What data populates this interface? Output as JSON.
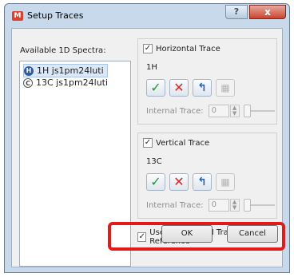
{
  "window": {
    "title": "Setup Traces",
    "help": "?",
    "close": "x"
  },
  "list": {
    "label": "Available 1D Spectra:",
    "items": [
      {
        "badge": "H",
        "label": "1H js1pm24luti"
      },
      {
        "badge": "C",
        "label": "13C js1pm24luti"
      }
    ]
  },
  "horizontal": {
    "checkbox_label": "Horizontal Trace",
    "checked": "✓",
    "nucleus": "1H",
    "internal_label": "Internal Trace:",
    "internal_value": "0"
  },
  "vertical": {
    "checkbox_label": "Vertical Trace",
    "checked": "✓",
    "nucleus": "13C",
    "internal_label": "Internal Trace:",
    "internal_value": "0"
  },
  "reference": {
    "checkbox_label": "Use External 1H Trace as Reference",
    "checked": "✓"
  },
  "buttons": {
    "ok": "OK",
    "cancel": "Cancel"
  },
  "icons": {
    "accept": "✓",
    "remove": "✕",
    "import": "↰",
    "grid": "▦",
    "spin_up": "▲",
    "spin_down": "▼"
  }
}
